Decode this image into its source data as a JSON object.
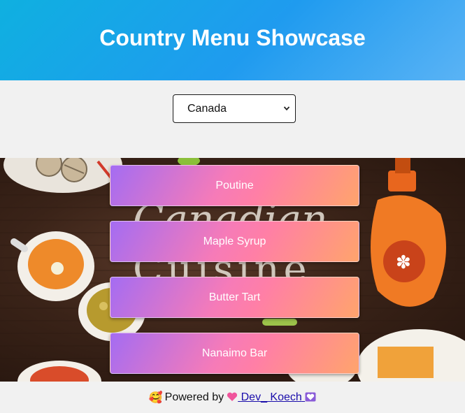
{
  "header": {
    "title": "Country Menu Showcase"
  },
  "country_select": {
    "selected": "Canada"
  },
  "hero": {
    "background_text": [
      "Canadian",
      "Cuisine"
    ]
  },
  "menu": {
    "items": [
      {
        "label": "Poutine"
      },
      {
        "label": "Maple Syrup"
      },
      {
        "label": "Butter Tart"
      },
      {
        "label": "Nanaimo Bar"
      }
    ]
  },
  "footer": {
    "lead_emoji": "🥰",
    "text": "Powered by",
    "link_text": "Dev_ Koech"
  },
  "colors": {
    "header_start": "#0fb0e0",
    "header_end": "#5ab3f5",
    "button_start": "#a46cf2",
    "button_mid": "#ff7fa6",
    "button_end": "#ffa46c",
    "link": "#1a0dab"
  }
}
